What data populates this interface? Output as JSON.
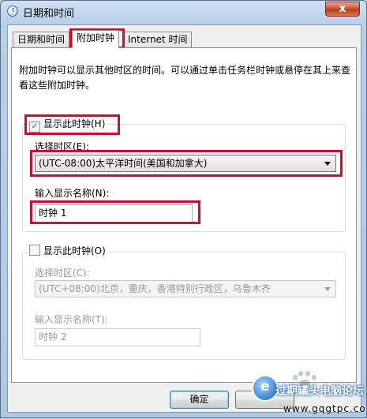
{
  "window": {
    "title": "日期和时间",
    "close_glyph": "x"
  },
  "tabs": [
    {
      "label": "日期和时间"
    },
    {
      "label": "附加时钟"
    },
    {
      "label": "Internet 时间"
    }
  ],
  "description": "附加时钟可以显示其他时区的时间。可以通过单击任务栏时钟或悬停在其上来查看这些附加时钟。",
  "clock1": {
    "checkbox_label": "显示此时钟(H)",
    "checked": true,
    "timezone_label": "选择时区(E):",
    "timezone_value": "(UTC-08:00)太平洋时间(美国和加拿大)",
    "name_label": "输入显示名称(N):",
    "name_value": "时钟 1"
  },
  "clock2": {
    "checkbox_label": "显示此时钟(O)",
    "checked": false,
    "timezone_label": "选择时区(C):",
    "timezone_value": "(UTC+08:00)北京，重庆，香港特别行政区，乌鲁木齐",
    "name_label": "输入显示名称(T):",
    "name_value": "时钟 2"
  },
  "buttons": {
    "ok": "确定"
  },
  "watermark": {
    "text": "过期罐头电脑论坛",
    "url": "www.gqgtpc.com",
    "logo_letter": "e"
  },
  "colors": {
    "highlight": "#c8102e",
    "title_bar": "#b8cfea",
    "close_button": "#c8583b"
  }
}
